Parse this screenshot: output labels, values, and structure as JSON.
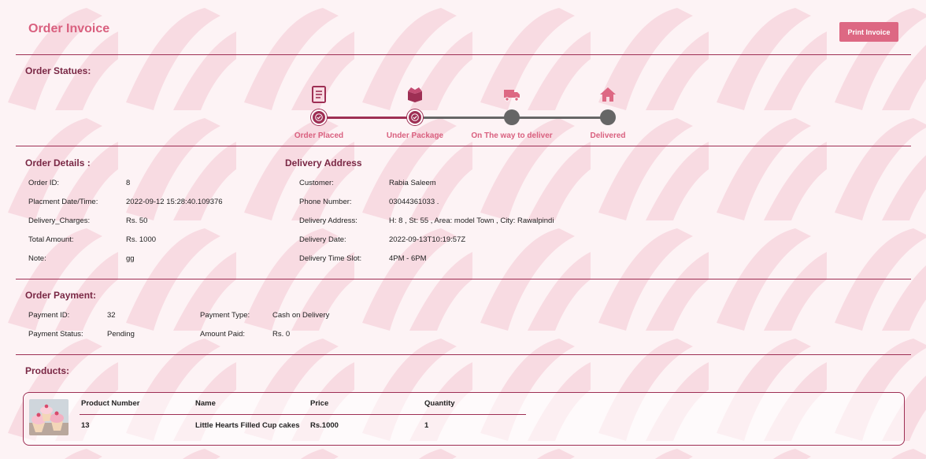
{
  "header": {
    "title": "Order Invoice",
    "print_button": "Print Invoice"
  },
  "statuses": {
    "heading": "Order Statues:",
    "steps": [
      {
        "label": "Order Placed",
        "icon": "document-icon",
        "state": "done"
      },
      {
        "label": "Under Package",
        "icon": "box-icon",
        "state": "done"
      },
      {
        "label": "On The way to deliver",
        "icon": "truck-icon",
        "state": "pending"
      },
      {
        "label": "Delivered",
        "icon": "home-icon",
        "state": "pending"
      }
    ]
  },
  "order_details": {
    "heading": "Order Details :",
    "rows": [
      {
        "label": "Order ID:",
        "value": "8"
      },
      {
        "label": "Placment Date/Time:",
        "value": "2022-09-12 15:28:40.109376"
      },
      {
        "label": "Delivery_Charges:",
        "value": "Rs. 50"
      },
      {
        "label": "Total Amount:",
        "value": "Rs. 1000"
      },
      {
        "label": "Note:",
        "value": "gg"
      }
    ]
  },
  "delivery_address": {
    "heading": "Delivery Address",
    "rows": [
      {
        "label": "Customer:",
        "value": "Rabia Saleem"
      },
      {
        "label": "Phone Number:",
        "value": "03044361033 ."
      },
      {
        "label": "Delivery Address:",
        "value": "H: 8 , St: 55 , Area: model Town , City: Rawalpindi"
      },
      {
        "label": "Delivery Date:",
        "value": "2022-09-13T10:19:57Z"
      },
      {
        "label": "Delivery Time Slot:",
        "value": "4PM - 6PM"
      }
    ]
  },
  "payment": {
    "heading": "Order Payment:",
    "payment_id_label": "Payment ID:",
    "payment_id": "32",
    "payment_type_label": "Payment Type:",
    "payment_type": "Cash on Delivery",
    "payment_status_label": "Payment Status:",
    "payment_status": "Pending",
    "amount_paid_label": "Amount Paid:",
    "amount_paid": "Rs. 0"
  },
  "products": {
    "heading": "Products:",
    "columns": [
      "Product Number",
      "Name",
      "Price",
      "Quantity"
    ],
    "rows": [
      {
        "number": "13",
        "name": "Little Hearts Filled Cup cakes",
        "price": "Rs.1000",
        "quantity": "1",
        "image": "cupcakes-thumbnail"
      }
    ]
  },
  "colors": {
    "accent": "#d9607f",
    "dark_accent": "#9e2f54",
    "pending": "#666666",
    "background": "#fdf3f5",
    "pattern": "#f8dbe2"
  }
}
